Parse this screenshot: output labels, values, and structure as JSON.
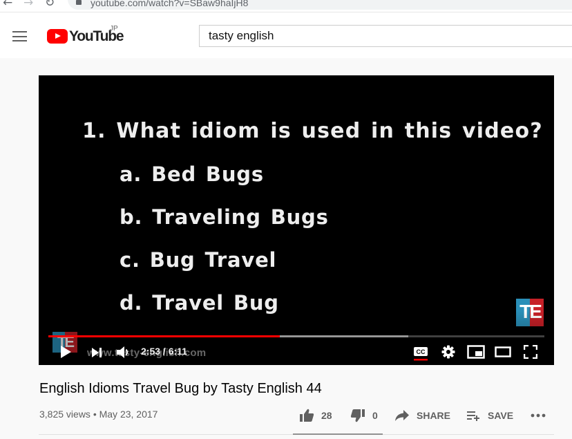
{
  "browser": {
    "url": "youtube.com/watch?v=SBaw9haIjH8"
  },
  "header": {
    "logo_text": "YouTube",
    "region": "JP",
    "search_value": "tasty english"
  },
  "player": {
    "quiz": {
      "question": "1. What idiom is used in this video?",
      "options": [
        "a. Bed Bugs",
        "b. Traveling Bugs",
        "c. Bug Travel",
        "d. Travel Bug"
      ]
    },
    "logo_text": "TE",
    "watermark": "www.tasty-english.com",
    "current_time": "2:53",
    "duration": "6:11",
    "time_display": "2:53 / 6:11",
    "played_fraction": 0.466,
    "buffered_fraction": 0.725
  },
  "video": {
    "title": "English Idioms Travel Bug by Tasty English 44",
    "meta": "3,825 views • May 23, 2017",
    "likes": "28",
    "dislikes": "0",
    "share_label": "SHARE",
    "save_label": "SAVE"
  },
  "colors": {
    "brand_red": "#ff0000",
    "progress_red": "#ff0000",
    "te_blue": "#2a8fb8",
    "te_red": "#c72027"
  },
  "icons": [
    "back-icon",
    "forward-icon",
    "reload-icon",
    "lock-icon",
    "menu-icon",
    "play-icon",
    "next-icon",
    "volume-icon",
    "captions-icon",
    "settings-icon",
    "miniplayer-icon",
    "theater-icon",
    "fullscreen-icon",
    "thumbs-up-icon",
    "thumbs-down-icon",
    "share-icon",
    "save-playlist-icon",
    "more-icon"
  ]
}
